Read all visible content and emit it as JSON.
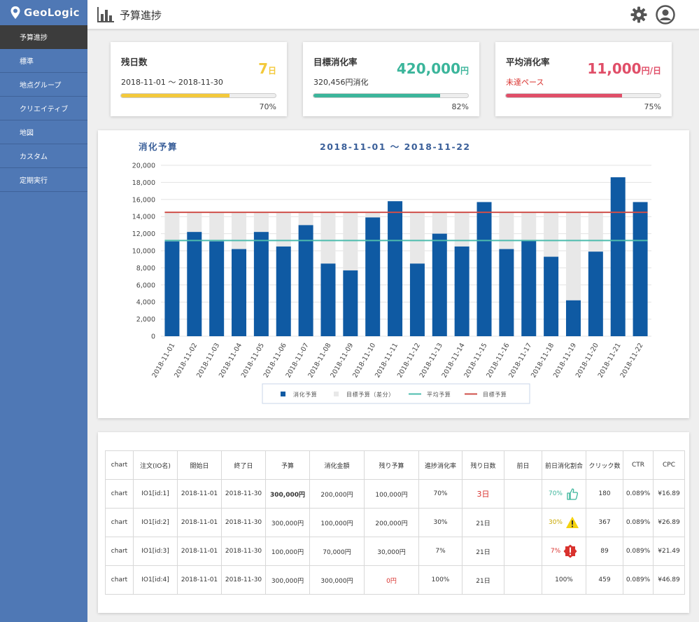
{
  "app": {
    "logo_text": "GeoLogic"
  },
  "sidebar": {
    "items": [
      {
        "label": "予算進捗",
        "active": true
      },
      {
        "label": "標準"
      },
      {
        "label": "地点グループ"
      },
      {
        "label": "クリエイティブ"
      },
      {
        "label": "地図"
      },
      {
        "label": "カスタム"
      },
      {
        "label": "定期実行"
      }
    ]
  },
  "header": {
    "title": "予算進捗",
    "icons": [
      "chart-icon",
      "gear-icon",
      "user-icon"
    ]
  },
  "kpis": [
    {
      "title": "残日数",
      "value": "7",
      "unit": "日",
      "sub": "2018-11-01 〜 2018-11-30",
      "percent_text": "70%",
      "progress": 0.7,
      "color": "#f3c93b"
    },
    {
      "title": "目標消化率",
      "value": "420,000",
      "unit": "円",
      "sub": "320,456円消化",
      "percent_text": "82%",
      "progress": 0.82,
      "color": "#3bb59b"
    },
    {
      "title": "平均消化率",
      "value": "11,000",
      "unit": "円/日",
      "sub": "未達ペース",
      "percent_text": "75%",
      "progress": 0.75,
      "color": "#e04e68"
    }
  ],
  "chart_data": {
    "type": "bar",
    "title": "消化予算",
    "subtitle": "2018-11-01 〜 2018-11-22",
    "categories": [
      "2018-11-01",
      "2018-11-02",
      "2018-11-03",
      "2018-11-04",
      "2018-11-05",
      "2018-11-06",
      "2018-11-07",
      "2018-11-08",
      "2018-11-09",
      "2018-11-10",
      "2018-11-11",
      "2018-11-12",
      "2018-11-13",
      "2018-11-14",
      "2018-11-15",
      "2018-11-16",
      "2018-11-17",
      "2018-11-18",
      "2018-11-19",
      "2018-11-20",
      "2018-11-21",
      "2018-11-22"
    ],
    "series": [
      {
        "name": "消化予算",
        "color": "#0f5aa3",
        "values": [
          11100,
          12200,
          11100,
          10200,
          12200,
          10500,
          13000,
          8500,
          7700,
          13900,
          15800,
          8500,
          12000,
          10500,
          15700,
          10200,
          11200,
          9300,
          4200,
          9900,
          18600,
          15700
        ]
      },
      {
        "name": "目標予算（差分）",
        "color": "#e8e8e8",
        "values": [
          3400,
          2300,
          3400,
          4300,
          2300,
          4000,
          1500,
          6000,
          6800,
          600,
          0,
          6000,
          2500,
          4000,
          0,
          4300,
          3300,
          5200,
          10300,
          4600,
          0,
          0
        ]
      },
      {
        "name": "平均予算",
        "color": "#4dbcae",
        "line_value": 11200
      },
      {
        "name": "目標予算",
        "color": "#cf4f4a",
        "line_value": 14500
      }
    ],
    "ylim": [
      0,
      20000
    ],
    "yticks": [
      "20,000",
      "18,000",
      "16,000",
      "14,000",
      "12,000",
      "10,000",
      "8,000",
      "6,000",
      "4,000",
      "2,000",
      "0"
    ],
    "legend_position": "bottom",
    "grid": true
  },
  "table": {
    "headers": [
      "chart",
      "注文(IO名)",
      "開始日",
      "終了日",
      "予算",
      "消化金額",
      "残り予算",
      "進捗消化率",
      "残り日数",
      "前日",
      "前日消化割合",
      "クリック数",
      "CTR",
      "CPC"
    ],
    "rows": [
      {
        "chart": "chart",
        "io": "IO1[id:1]",
        "start": "2018-11-01",
        "end": "2018-11-30",
        "budget": "300,000円",
        "spent": "200,000円",
        "remaining": "100,000円",
        "progress": "70%",
        "days_left": "3日",
        "prev": "",
        "prev_ratio": "70%",
        "ratio_icon": "thumbs-up-icon",
        "ratio_color": "#3bb59b",
        "clicks": "180",
        "ctr": "0.089%",
        "cpc": "¥16.89"
      },
      {
        "chart": "chart",
        "io": "IO1[id:2]",
        "start": "2018-11-01",
        "end": "2018-11-30",
        "budget": "300,000円",
        "spent": "100,000円",
        "remaining": "200,000円",
        "progress": "30%",
        "days_left": "21日",
        "prev": "",
        "prev_ratio": "30%",
        "ratio_icon": "warning-icon",
        "ratio_color": "#c9a800",
        "clicks": "367",
        "ctr": "0.089%",
        "cpc": "¥26.89"
      },
      {
        "chart": "chart",
        "io": "IO1[id:3]",
        "start": "2018-11-01",
        "end": "2018-11-30",
        "budget": "100,000円",
        "spent": "70,000円",
        "remaining": "30,000円",
        "progress": "7%",
        "days_left": "21日",
        "prev": "",
        "prev_ratio": "7%",
        "ratio_icon": "alert-icon",
        "ratio_color": "#d9322e",
        "clicks": "89",
        "ctr": "0.089%",
        "cpc": "¥21.49"
      },
      {
        "chart": "chart",
        "io": "IO1[id:4]",
        "start": "2018-11-01",
        "end": "2018-11-30",
        "budget": "300,000円",
        "spent": "300,000円",
        "remaining": "0円",
        "progress": "100%",
        "days_left": "21日",
        "prev": "",
        "prev_ratio": "100%",
        "ratio_icon": "",
        "ratio_color": "#333333",
        "clicks": "459",
        "ctr": "0.089%",
        "cpc": "¥46.89"
      }
    ]
  }
}
